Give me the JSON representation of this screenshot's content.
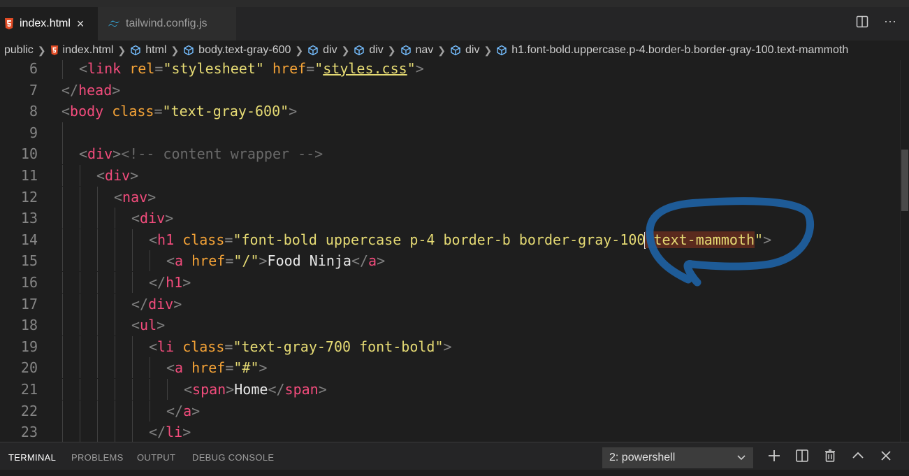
{
  "tabs": [
    {
      "label": "index.html",
      "close": "×",
      "icon": "html5-icon",
      "active": true
    },
    {
      "label": "tailwind.config.js",
      "icon": "tailwind-icon",
      "active": false
    }
  ],
  "tab_actions": {
    "split": "split-editor-icon",
    "more": "···"
  },
  "breadcrumb": [
    "public",
    "index.html",
    "html",
    "body.text-gray-600",
    "div",
    "div",
    "nav",
    "div",
    "h1.font-bold.uppercase.p-4.border-b.border-gray-100.text-mammoth"
  ],
  "lines": [
    {
      "n": "6",
      "indent": 1,
      "tokens": [
        {
          "c": "t-punc",
          "t": "<"
        },
        {
          "c": "t-tag",
          "t": "link"
        },
        {
          "c": "t-txt",
          "t": " "
        },
        {
          "c": "t-attr",
          "t": "rel"
        },
        {
          "c": "t-punc",
          "t": "="
        },
        {
          "c": "t-str",
          "t": "\"stylesheet\""
        },
        {
          "c": "t-txt",
          "t": " "
        },
        {
          "c": "t-attr",
          "t": "href"
        },
        {
          "c": "t-punc",
          "t": "="
        },
        {
          "c": "t-str",
          "t": "\""
        },
        {
          "c": "t-str t-ul",
          "t": "styles.css"
        },
        {
          "c": "t-str",
          "t": "\""
        },
        {
          "c": "t-punc",
          "t": ">"
        }
      ]
    },
    {
      "n": "7",
      "indent": 0,
      "tokens": [
        {
          "c": "t-punc",
          "t": "</"
        },
        {
          "c": "t-tag",
          "t": "head"
        },
        {
          "c": "t-punc",
          "t": ">"
        }
      ]
    },
    {
      "n": "8",
      "indent": 0,
      "tokens": [
        {
          "c": "t-punc",
          "t": "<"
        },
        {
          "c": "t-tag",
          "t": "body"
        },
        {
          "c": "t-txt",
          "t": " "
        },
        {
          "c": "t-attr",
          "t": "class"
        },
        {
          "c": "t-punc",
          "t": "="
        },
        {
          "c": "t-str",
          "t": "\"text-gray-600\""
        },
        {
          "c": "t-punc",
          "t": ">"
        }
      ]
    },
    {
      "n": "9",
      "indent": 0,
      "guides": 1,
      "tokens": []
    },
    {
      "n": "10",
      "indent": 1,
      "tokens": [
        {
          "c": "t-punc",
          "t": "<"
        },
        {
          "c": "t-tag",
          "t": "div"
        },
        {
          "c": "t-punc",
          "t": ">"
        },
        {
          "c": "t-com",
          "t": "<!-- content wrapper -->"
        }
      ]
    },
    {
      "n": "11",
      "indent": 2,
      "tokens": [
        {
          "c": "t-punc",
          "t": "<"
        },
        {
          "c": "t-tag",
          "t": "div"
        },
        {
          "c": "t-punc",
          "t": ">"
        }
      ]
    },
    {
      "n": "12",
      "indent": 3,
      "tokens": [
        {
          "c": "t-punc",
          "t": "<"
        },
        {
          "c": "t-tag",
          "t": "nav"
        },
        {
          "c": "t-punc",
          "t": ">"
        }
      ]
    },
    {
      "n": "13",
      "indent": 4,
      "tokens": [
        {
          "c": "t-punc",
          "t": "<"
        },
        {
          "c": "t-tag",
          "t": "div"
        },
        {
          "c": "t-punc",
          "t": ">"
        }
      ]
    },
    {
      "n": "14",
      "indent": 5,
      "tokens": [
        {
          "c": "t-punc",
          "t": "<"
        },
        {
          "c": "t-tag",
          "t": "h1"
        },
        {
          "c": "t-txt",
          "t": " "
        },
        {
          "c": "t-attr",
          "t": "class"
        },
        {
          "c": "t-punc",
          "t": "="
        },
        {
          "c": "t-str",
          "t": "\"font-bold uppercase p-4 border-b border-gray-100"
        },
        {
          "c": "caret",
          "t": ""
        },
        {
          "c": "t-str t-hl",
          "t": " text-mammoth"
        },
        {
          "c": "t-str",
          "t": "\""
        },
        {
          "c": "t-punc",
          "t": ">"
        }
      ]
    },
    {
      "n": "15",
      "indent": 6,
      "tokens": [
        {
          "c": "t-punc",
          "t": "<"
        },
        {
          "c": "t-tag",
          "t": "a"
        },
        {
          "c": "t-txt",
          "t": " "
        },
        {
          "c": "t-attr",
          "t": "href"
        },
        {
          "c": "t-punc",
          "t": "="
        },
        {
          "c": "t-str",
          "t": "\"/\""
        },
        {
          "c": "t-punc",
          "t": ">"
        },
        {
          "c": "t-txt",
          "t": "Food Ninja"
        },
        {
          "c": "t-punc",
          "t": "</"
        },
        {
          "c": "t-tag",
          "t": "a"
        },
        {
          "c": "t-punc",
          "t": ">"
        }
      ]
    },
    {
      "n": "16",
      "indent": 5,
      "tokens": [
        {
          "c": "t-punc",
          "t": "</"
        },
        {
          "c": "t-tag",
          "t": "h1"
        },
        {
          "c": "t-punc",
          "t": ">"
        }
      ]
    },
    {
      "n": "17",
      "indent": 4,
      "tokens": [
        {
          "c": "t-punc",
          "t": "</"
        },
        {
          "c": "t-tag",
          "t": "div"
        },
        {
          "c": "t-punc",
          "t": ">"
        }
      ]
    },
    {
      "n": "18",
      "indent": 4,
      "tokens": [
        {
          "c": "t-punc",
          "t": "<"
        },
        {
          "c": "t-tag",
          "t": "ul"
        },
        {
          "c": "t-punc",
          "t": ">"
        }
      ]
    },
    {
      "n": "19",
      "indent": 5,
      "tokens": [
        {
          "c": "t-punc",
          "t": "<"
        },
        {
          "c": "t-tag",
          "t": "li"
        },
        {
          "c": "t-txt",
          "t": " "
        },
        {
          "c": "t-attr",
          "t": "class"
        },
        {
          "c": "t-punc",
          "t": "="
        },
        {
          "c": "t-str",
          "t": "\"text-gray-700 font-bold\""
        },
        {
          "c": "t-punc",
          "t": ">"
        }
      ]
    },
    {
      "n": "20",
      "indent": 6,
      "tokens": [
        {
          "c": "t-punc",
          "t": "<"
        },
        {
          "c": "t-tag",
          "t": "a"
        },
        {
          "c": "t-txt",
          "t": " "
        },
        {
          "c": "t-attr",
          "t": "href"
        },
        {
          "c": "t-punc",
          "t": "="
        },
        {
          "c": "t-str",
          "t": "\"#\""
        },
        {
          "c": "t-punc",
          "t": ">"
        }
      ]
    },
    {
      "n": "21",
      "indent": 7,
      "tokens": [
        {
          "c": "t-punc",
          "t": "<"
        },
        {
          "c": "t-tag",
          "t": "span"
        },
        {
          "c": "t-punc",
          "t": ">"
        },
        {
          "c": "t-txt",
          "t": "Home"
        },
        {
          "c": "t-punc",
          "t": "</"
        },
        {
          "c": "t-tag",
          "t": "span"
        },
        {
          "c": "t-punc",
          "t": ">"
        }
      ]
    },
    {
      "n": "22",
      "indent": 6,
      "tokens": [
        {
          "c": "t-punc",
          "t": "</"
        },
        {
          "c": "t-tag",
          "t": "a"
        },
        {
          "c": "t-punc",
          "t": ">"
        }
      ]
    },
    {
      "n": "23",
      "indent": 5,
      "tokens": [
        {
          "c": "t-punc",
          "t": "</"
        },
        {
          "c": "t-tag",
          "t": "li"
        },
        {
          "c": "t-punc",
          "t": ">"
        }
      ]
    }
  ],
  "panel": {
    "tabs": [
      "TERMINAL",
      "PROBLEMS",
      "OUTPUT",
      "DEBUG CONSOLE"
    ],
    "active_tab": "TERMINAL",
    "shell": "2: powershell",
    "actions": [
      "plus-icon",
      "split-terminal-icon",
      "trash-icon",
      "chevron-up-icon",
      "close-icon"
    ]
  },
  "colors": {
    "tag": "#f24c7c",
    "attr": "#f5a337",
    "string": "#e6db74",
    "annotation": "#1f5f9e"
  }
}
